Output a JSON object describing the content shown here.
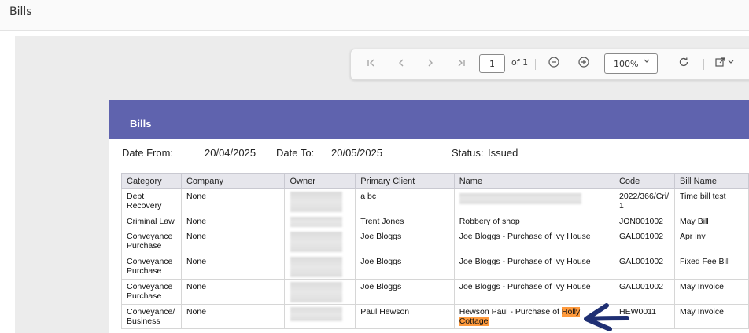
{
  "app": {
    "title": "Bills"
  },
  "toolbar": {
    "first_icon": "first-page-icon",
    "prev_icon": "previous-page-icon",
    "next_icon": "next-page-icon",
    "last_icon": "last-page-icon",
    "page_value": "1",
    "of_label": "of 1",
    "zoom_out_icon": "zoom-out-icon",
    "zoom_in_icon": "zoom-in-icon",
    "zoom_value": "100%",
    "refresh_icon": "refresh-icon",
    "export_icon": "export-icon"
  },
  "report": {
    "title": "Bills",
    "filters": {
      "date_from_label": "Date From:",
      "date_from_value": "20/04/2025",
      "date_to_label": "Date To:",
      "date_to_value": "20/05/2025",
      "status_label": "Status:",
      "status_value": "Issued"
    },
    "columns": [
      "Category",
      "Company",
      "Owner",
      "Primary Client",
      "Name",
      "Code",
      "Bill Name"
    ],
    "rows": [
      {
        "category": "Debt Recovery",
        "company": "None",
        "owner": "",
        "client": "a bc",
        "name": "",
        "code": "2022/366/Cri/ 1",
        "bill": "Time bill test"
      },
      {
        "category": "Criminal Law",
        "company": "None",
        "owner": "",
        "client": "Trent Jones",
        "name": "Robbery of shop",
        "code": "JON001002",
        "bill": "May Bill"
      },
      {
        "category": "Conveyance Purchase",
        "company": "None",
        "owner": "",
        "client": "Joe Bloggs",
        "name": "Joe Bloggs - Purchase of Ivy House",
        "code": "GAL001002",
        "bill": "Apr inv"
      },
      {
        "category": "Conveyance Purchase",
        "company": "None",
        "owner": "",
        "client": "Joe Bloggs",
        "name": "Joe Bloggs - Purchase of Ivy House",
        "code": "GAL001002",
        "bill": "Fixed Fee Bill"
      },
      {
        "category": "Conveyance Purchase",
        "company": "None",
        "owner": "",
        "client": "Joe Bloggs",
        "name": "Joe Bloggs - Purchase of Ivy House",
        "code": "GAL001002",
        "bill": "May Invoice"
      },
      {
        "category": "Conveyance/ Business",
        "company": "None",
        "owner": "",
        "client": "Paul Hewson",
        "name_prefix": "Hewson Paul - Purchase of ",
        "name_hl1": "Holly",
        "name_hl2": "Cottage",
        "code": "HEW0011",
        "bill": "May Invoice"
      }
    ],
    "highlight_color": "#ff9a3c",
    "header_color": "#5f63ae",
    "annotation_arrow_color": "#1f2f73"
  }
}
